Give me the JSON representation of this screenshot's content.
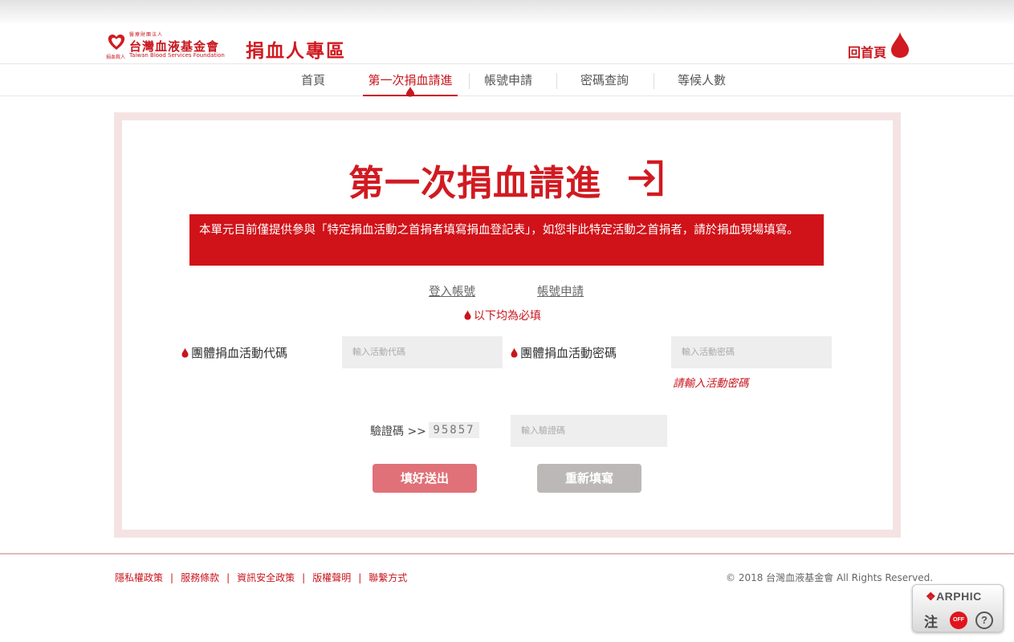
{
  "header": {
    "org_sub": "醫療財團法人",
    "org_name": "台灣血液基金會",
    "org_en": "Taiwan Blood Services Foundation",
    "org_tag": "捐血救人",
    "zone_title": "捐血人專區",
    "home_label": "回首頁"
  },
  "nav": {
    "items": [
      "首頁",
      "第一次捐血請進",
      "帳號申請",
      "密碼查詢",
      "等候人數"
    ]
  },
  "main": {
    "title": "第一次捐血請進",
    "notice": "本單元目前僅提供參與「特定捐血活動之首捐者填寫捐血登記表」，如您非此特定活動之首捐者，請於捐血現場填寫。",
    "login_link": "登入帳號",
    "apply_link": "帳號申請",
    "required_note": "以下均為必填"
  },
  "form": {
    "code_label": "團體捐血活動代碼",
    "code_placeholder": "輸入活動代碼",
    "password_label": "團體捐血活動密碼",
    "password_placeholder": "輸入活動密碼",
    "password_error": "請輸入活動密碼",
    "captcha_label": "驗證碼 >>",
    "captcha_code": "95857",
    "captcha_placeholder": "輸入驗證碼",
    "submit_label": "填好送出",
    "reset_label": "重新填寫"
  },
  "footer": {
    "links": [
      "隱私權政策",
      "服務條款",
      "資訊安全政策",
      "版權聲明",
      "聯繫方式"
    ],
    "copyright": "© 2018 台灣血液基金會 All Rights Reserved."
  },
  "arphic": {
    "brand": "ARPHIC",
    "zhu_label": "注",
    "off_label": "OFF",
    "help_label": "?"
  },
  "colors": {
    "brand_red": "#d11a21",
    "notice_bg": "#d01219",
    "submit_bg": "#e07178",
    "reset_bg": "#bdb8b8",
    "frame_bg": "#f5e3e4"
  }
}
